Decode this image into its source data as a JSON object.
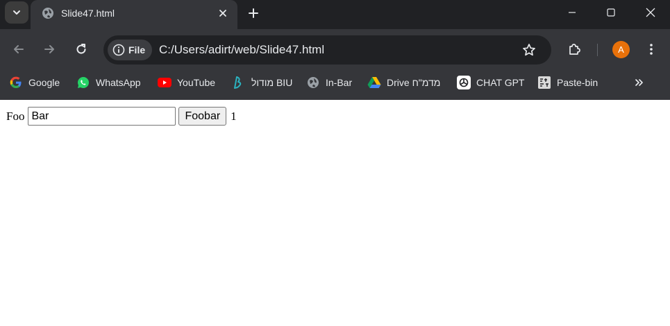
{
  "colors": {
    "tabstrip_bg": "#202124",
    "toolbar_bg": "#35363a",
    "omnibox_bg": "#202124",
    "text_light": "#e8eaed",
    "avatar_bg": "#e8710a"
  },
  "tabstrip": {
    "search_icon": "chevron-down-icon",
    "tabs": [
      {
        "title": "Slide47.html",
        "favicon": "globe-icon",
        "active": true
      }
    ],
    "new_tab_icon": "plus-icon",
    "window_controls": [
      "minimize-icon",
      "maximize-icon",
      "close-icon"
    ]
  },
  "toolbar": {
    "back_icon": "arrow-left-icon",
    "forward_icon": "arrow-right-icon",
    "reload_icon": "reload-icon",
    "omnibox": {
      "chip_label": "File",
      "chip_icon": "info-icon",
      "url": "C:/Users/adirt/web/Slide47.html",
      "bookmark_icon": "star-icon"
    },
    "extensions_icon": "puzzle-icon",
    "avatar_letter": "A",
    "menu_icon": "kebab-menu-icon"
  },
  "bookmarks": {
    "items": [
      {
        "label": "Google",
        "icon": "google-icon"
      },
      {
        "label": "WhatsApp",
        "icon": "whatsapp-icon"
      },
      {
        "label": "YouTube",
        "icon": "youtube-icon"
      },
      {
        "label": "מודול BIU",
        "icon": "biu-icon"
      },
      {
        "label": "In-Bar",
        "icon": "globe-icon"
      },
      {
        "label": "Drive מדמ\"ח",
        "icon": "google-drive-icon"
      },
      {
        "label": "CHAT GPT",
        "icon": "chatgpt-icon"
      },
      {
        "label": "Paste-bin",
        "icon": "pastebin-icon"
      }
    ],
    "more_icon": "double-chevron-right-icon"
  },
  "page": {
    "label": "Foo",
    "input_value": "Bar",
    "button_label": "Foobar",
    "count": "1"
  }
}
